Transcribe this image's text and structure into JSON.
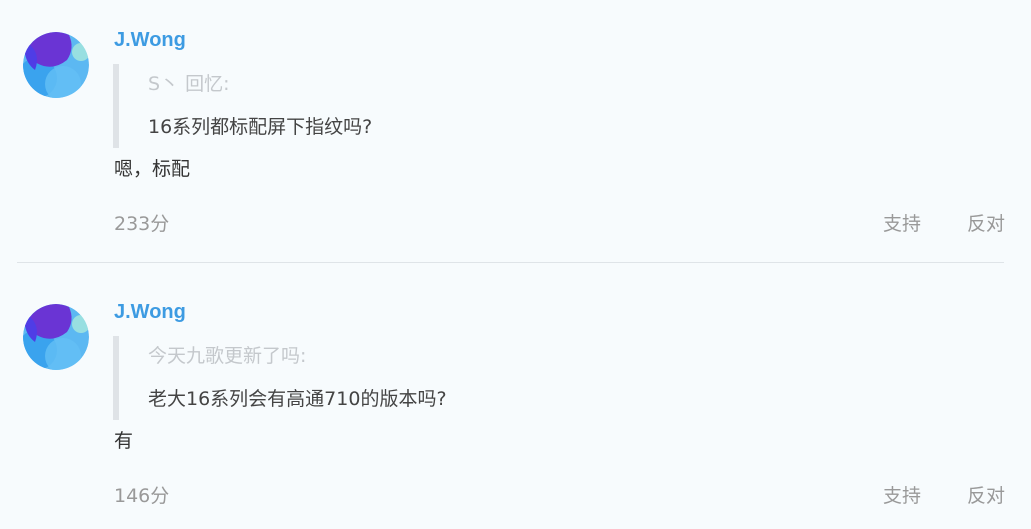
{
  "comments": [
    {
      "username": "J.Wong",
      "avatar_icon": "avatar-icon",
      "quote": {
        "author": "S丶 回忆:",
        "text": "16系列都标配屏下指纹吗?"
      },
      "reply": "嗯，标配",
      "score": "233分",
      "support_label": "支持",
      "oppose_label": "反对"
    },
    {
      "username": "J.Wong",
      "avatar_icon": "avatar-icon",
      "quote": {
        "author": "今天九歌更新了吗:",
        "text": "老大16系列会有高通710的版本吗?"
      },
      "reply": "有",
      "score": "146分",
      "support_label": "支持",
      "oppose_label": "反对"
    }
  ],
  "colors": {
    "background": "#f7fbfd",
    "username": "#3d9be2",
    "quote_author": "#c4c8cc",
    "quote_bar": "#dfe3e7",
    "meta": "#999999"
  }
}
